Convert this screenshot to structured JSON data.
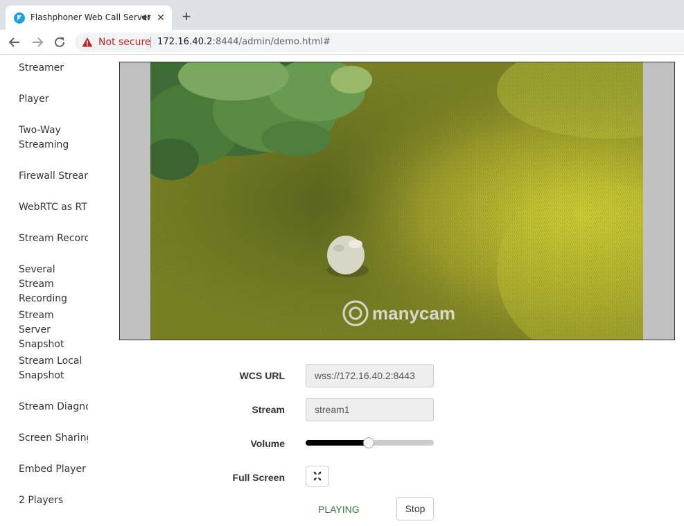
{
  "browser": {
    "tab_title": "Flashphoner Web Call Server",
    "tab_close": "✕",
    "new_tab": "+",
    "not_secure_label": "Not secure",
    "url_host": "172.16.40.2",
    "url_rest": ":8444/admin/demo.html#",
    "icons": [
      "flashphoner-favicon-icon",
      "speaker-icon",
      "close-icon",
      "plus-icon",
      "back-arrow-icon",
      "forward-arrow-icon",
      "reload-icon",
      "warning-icon"
    ]
  },
  "sidebar": {
    "items": [
      {
        "label": "Streamer"
      },
      {
        "label": "Player"
      },
      {
        "label": "Two-Way Streaming"
      },
      {
        "label": "Firewall Stream"
      },
      {
        "label": "WebRTC as RTM"
      },
      {
        "label": "Stream Recordi"
      },
      {
        "label": "Several Stream Recording"
      },
      {
        "label": "Stream Server Snapshot"
      },
      {
        "label": "Stream Local Snapshot"
      },
      {
        "label": "Stream Diagno"
      },
      {
        "label": "Screen Sharing"
      },
      {
        "label": "Embed Player"
      },
      {
        "label": "2 Players"
      }
    ]
  },
  "video": {
    "watermark": "manycam"
  },
  "form": {
    "wcs_url_label": "WCS URL",
    "wcs_url_value": "wss://172.16.40.2:8443",
    "stream_label": "Stream",
    "stream_value": "stream1",
    "volume_label": "Volume",
    "volume_level": 0.49,
    "fullscreen_label": "Full Screen",
    "status": "PLAYING",
    "stop_label": "Stop"
  },
  "colors": {
    "status_green": "#3c763d",
    "warning_red": "#c5221f",
    "favicon_blue": "#1ba1e2"
  }
}
